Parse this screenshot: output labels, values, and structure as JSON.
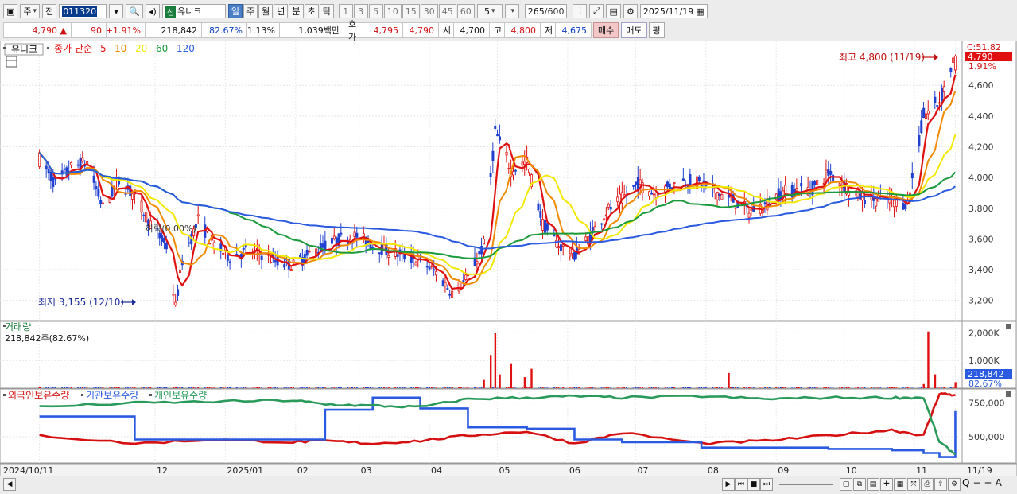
{
  "toolbar": {
    "period_type": "주",
    "prev_label": "전",
    "code": "011320",
    "market_badge": "신",
    "name": "유니크",
    "intervals": [
      "일",
      "주",
      "월",
      "년",
      "분",
      "초",
      "틱"
    ],
    "active_interval": "일",
    "multipliers": [
      "1",
      "3",
      "5",
      "10",
      "15",
      "30",
      "45",
      "60"
    ],
    "multiplier_value": "5",
    "count": "265",
    "count_max": "/600",
    "date": "2025/11/19"
  },
  "quote": {
    "price": "4,790",
    "change_arrow": "▲",
    "change": "90",
    "change_pct": "+1.91%",
    "volume": "218,842",
    "volume_ratio": "82.67%",
    "turnover_rate": "1.13%",
    "amount": "1,039백만",
    "hoga_label": "호가",
    "ask": "4,795",
    "bid": "4,790",
    "open_label": "시",
    "open": "4,700",
    "high_label": "고",
    "high": "4,800",
    "low_label": "저",
    "low": "4,675",
    "buy_button": "매수",
    "sell_button": "매도",
    "eval_button": "평"
  },
  "colors": {
    "ma5": "#e01010",
    "ma10": "#f08a00",
    "ma20": "#f3e800",
    "ma60": "#1a9a3a",
    "ma120": "#2a5ae0",
    "up": "#e01010",
    "down": "#2040d0",
    "foreign": "#d61010",
    "institution": "#2a5ae0",
    "individual": "#2a9a5a"
  },
  "chart_data": [
    {
      "type": "candlestick",
      "title": "유니크",
      "legend": {
        "label": "종가 단순",
        "periods": [
          "5",
          "10",
          "20",
          "60",
          "120"
        ]
      },
      "x_tick_labels": [
        "2024/10/11",
        "12",
        "2025/01",
        "02",
        "03",
        "04",
        "05",
        "06",
        "07",
        "08",
        "09",
        "10",
        "11",
        "11/19"
      ],
      "y_ticks": [
        "3,200",
        "3,400",
        "3,600",
        "3,800",
        "4,000",
        "4,200",
        "4,400",
        "4,600"
      ],
      "ylim": [
        3100,
        4860
      ],
      "annotations": {
        "max_label": "최고 4,800 (11/19)",
        "min_label": "최저 3,155 (12/10)",
        "drop_label": "하락(0.00%)",
        "corner_label": "C:51.82",
        "last_price": "4,790",
        "last_pct": "1.91%"
      },
      "close_series": [
        {
          "date": "2024-10-11",
          "close": 4120
        },
        {
          "date": "2024-10-18",
          "close": 3960
        },
        {
          "date": "2024-10-25",
          "close": 4060
        },
        {
          "date": "2024-11-01",
          "close": 4100
        },
        {
          "date": "2024-11-08",
          "close": 3800
        },
        {
          "date": "2024-11-15",
          "close": 3980
        },
        {
          "date": "2024-11-22",
          "close": 3880
        },
        {
          "date": "2024-11-29",
          "close": 3700
        },
        {
          "date": "2024-12-06",
          "close": 3550
        },
        {
          "date": "2024-12-10",
          "close": 3160
        },
        {
          "date": "2024-12-13",
          "close": 3460
        },
        {
          "date": "2024-12-20",
          "close": 3720
        },
        {
          "date": "2024-12-27",
          "close": 3560
        },
        {
          "date": "2025-01-03",
          "close": 3480
        },
        {
          "date": "2025-01-10",
          "close": 3520
        },
        {
          "date": "2025-01-17",
          "close": 3500
        },
        {
          "date": "2025-01-24",
          "close": 3450
        },
        {
          "date": "2025-01-31",
          "close": 3430
        },
        {
          "date": "2025-02-07",
          "close": 3500
        },
        {
          "date": "2025-02-14",
          "close": 3560
        },
        {
          "date": "2025-02-21",
          "close": 3600
        },
        {
          "date": "2025-02-28",
          "close": 3620
        },
        {
          "date": "2025-03-07",
          "close": 3560
        },
        {
          "date": "2025-03-14",
          "close": 3520
        },
        {
          "date": "2025-03-21",
          "close": 3490
        },
        {
          "date": "2025-03-28",
          "close": 3460
        },
        {
          "date": "2025-04-04",
          "close": 3380
        },
        {
          "date": "2025-04-11",
          "close": 3250
        },
        {
          "date": "2025-04-18",
          "close": 3350
        },
        {
          "date": "2025-04-25",
          "close": 3560
        },
        {
          "date": "2025-04-30",
          "close": 4300
        },
        {
          "date": "2025-05-07",
          "close": 4050
        },
        {
          "date": "2025-05-14",
          "close": 4100
        },
        {
          "date": "2025-05-21",
          "close": 3700
        },
        {
          "date": "2025-05-28",
          "close": 3560
        },
        {
          "date": "2025-06-04",
          "close": 3500
        },
        {
          "date": "2025-06-11",
          "close": 3620
        },
        {
          "date": "2025-06-18",
          "close": 3780
        },
        {
          "date": "2025-06-25",
          "close": 3860
        },
        {
          "date": "2025-07-02",
          "close": 3960
        },
        {
          "date": "2025-07-09",
          "close": 3900
        },
        {
          "date": "2025-07-16",
          "close": 3940
        },
        {
          "date": "2025-07-23",
          "close": 3980
        },
        {
          "date": "2025-07-30",
          "close": 3960
        },
        {
          "date": "2025-08-06",
          "close": 3900
        },
        {
          "date": "2025-08-13",
          "close": 3850
        },
        {
          "date": "2025-08-20",
          "close": 3780
        },
        {
          "date": "2025-08-27",
          "close": 3820
        },
        {
          "date": "2025-09-03",
          "close": 3900
        },
        {
          "date": "2025-09-10",
          "close": 3920
        },
        {
          "date": "2025-09-17",
          "close": 3930
        },
        {
          "date": "2025-09-24",
          "close": 4030
        },
        {
          "date": "2025-10-01",
          "close": 3950
        },
        {
          "date": "2025-10-08",
          "close": 3880
        },
        {
          "date": "2025-10-15",
          "close": 3860
        },
        {
          "date": "2025-10-22",
          "close": 3850
        },
        {
          "date": "2025-10-29",
          "close": 3830
        },
        {
          "date": "2025-11-05",
          "close": 4400
        },
        {
          "date": "2025-11-12",
          "close": 4500
        },
        {
          "date": "2025-11-19",
          "close": 4790
        }
      ],
      "ma_end_values": {
        "5": 4610,
        "10": 4510,
        "20": 4190,
        "60": 4010,
        "120": 3930
      }
    },
    {
      "type": "bar",
      "title": "거래량",
      "value_label": "218,842주(82.67%)",
      "y_ticks": [
        "1,000K",
        "2,000K"
      ],
      "last_value": "218,842",
      "last_pct": "82.67%",
      "bars": [
        {
          "date": "2024-10-11",
          "value": 30000
        },
        {
          "date": "2024-11-15",
          "value": 25000
        },
        {
          "date": "2024-12-10",
          "value": 60000
        },
        {
          "date": "2025-01-10",
          "value": 20000
        },
        {
          "date": "2025-02-14",
          "value": 20000
        },
        {
          "date": "2025-03-14",
          "value": 18000
        },
        {
          "date": "2025-04-11",
          "value": 40000
        },
        {
          "date": "2025-04-25",
          "value": 300000
        },
        {
          "date": "2025-04-28",
          "value": 1200000
        },
        {
          "date": "2025-04-30",
          "value": 2000000
        },
        {
          "date": "2025-05-02",
          "value": 500000
        },
        {
          "date": "2025-05-07",
          "value": 900000
        },
        {
          "date": "2025-05-13",
          "value": 400000
        },
        {
          "date": "2025-05-16",
          "value": 700000
        },
        {
          "date": "2025-06-11",
          "value": 50000
        },
        {
          "date": "2025-07-09",
          "value": 40000
        },
        {
          "date": "2025-08-11",
          "value": 550000
        },
        {
          "date": "2025-08-20",
          "value": 30000
        },
        {
          "date": "2025-09-24",
          "value": 40000
        },
        {
          "date": "2025-10-22",
          "value": 30000
        },
        {
          "date": "2025-11-05",
          "value": 150000
        },
        {
          "date": "2025-11-07",
          "value": 2050000
        },
        {
          "date": "2025-11-10",
          "value": 500000
        },
        {
          "date": "2025-11-19",
          "value": 218842
        }
      ]
    },
    {
      "type": "line",
      "legend": [
        "외국인보유수량",
        "기관보유수량",
        "개인보유수량"
      ],
      "y_ticks": [
        "500,000",
        "750,000"
      ],
      "ylim": [
        330000,
        830000
      ],
      "x": [
        "2024-10-11",
        "2024-11-22",
        "2024-12-27",
        "2025-01-31",
        "2025-02-14",
        "2025-03-07",
        "2025-03-28",
        "2025-04-18",
        "2025-05-14",
        "2025-06-04",
        "2025-06-25",
        "2025-07-30",
        "2025-08-27",
        "2025-09-24",
        "2025-10-22",
        "2025-11-05",
        "2025-11-12",
        "2025-11-19"
      ],
      "series": [
        {
          "name": "외국인보유수량",
          "values": [
            510000,
            450000,
            480000,
            460000,
            470000,
            450000,
            470000,
            510000,
            540000,
            450000,
            530000,
            450000,
            470000,
            510000,
            550000,
            510000,
            820000,
            810000
          ]
        },
        {
          "name": "기관보유수량",
          "values": [
            650000,
            480000,
            480000,
            480000,
            700000,
            790000,
            710000,
            570000,
            560000,
            480000,
            460000,
            420000,
            420000,
            410000,
            400000,
            380000,
            350000,
            690000
          ]
        },
        {
          "name": "개인보유수량",
          "values": [
            720000,
            750000,
            760000,
            770000,
            740000,
            730000,
            720000,
            780000,
            790000,
            800000,
            790000,
            800000,
            780000,
            790000,
            790000,
            790000,
            460000,
            370000
          ]
        }
      ]
    }
  ],
  "bottom": {
    "zoom_buttons": [
      "Q",
      "−",
      "+",
      "A"
    ]
  }
}
